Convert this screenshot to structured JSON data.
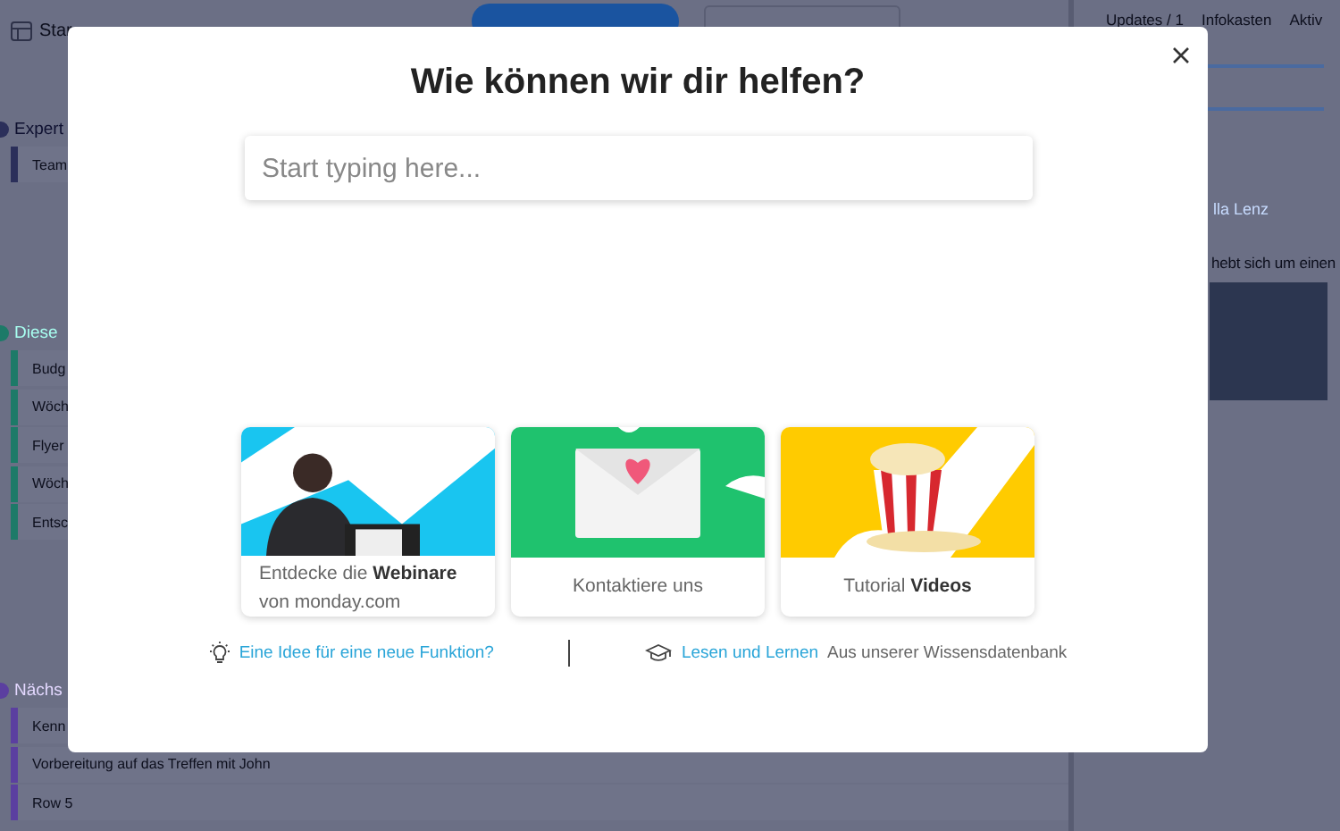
{
  "board": {
    "view_tab": "Star",
    "groups": [
      {
        "title": "Expert",
        "color": "#2b2f5a",
        "rows": [
          "Team"
        ]
      },
      {
        "title": "Diese",
        "color": "#1d7a68",
        "rows": [
          "Budg",
          "Wöch",
          "Flyer",
          "Wöch",
          "Entsc"
        ]
      },
      {
        "title": "Nächs",
        "color": "#5b3fa0",
        "rows": [
          "Kenn",
          "Vorbereitung auf das Treffen mit John",
          "Row 5"
        ]
      }
    ]
  },
  "side_panel": {
    "tabs": [
      "Updates / 1",
      "Infokasten",
      "Aktiv"
    ],
    "author": "lla Lenz",
    "post_text": "hebt sich um einen"
  },
  "help_dialog": {
    "title": "Wie können wir dir helfen?",
    "search": {
      "placeholder": "Start typing here..."
    },
    "cards": [
      {
        "kind": "webinar",
        "label": "Entdecke die **Webinare** von monday.com"
      },
      {
        "kind": "contact",
        "label": "Kontaktiere uns"
      },
      {
        "kind": "videos",
        "label": "Tutorial **Videos**"
      }
    ],
    "links": [
      {
        "kind": "idea",
        "link": "Eine Idee für eine neue Funktion?"
      },
      {
        "kind": "learn",
        "link": "Lesen und Lernen",
        "text": "Aus unserer Wissensdatenbank"
      }
    ]
  }
}
